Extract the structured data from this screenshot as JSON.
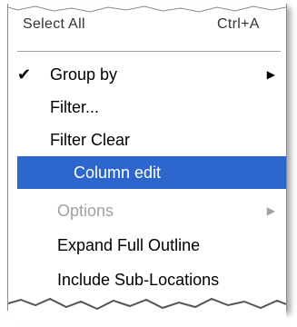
{
  "menu": {
    "top_item": {
      "label": "Select All",
      "shortcut": "Ctrl+A"
    },
    "items": [
      {
        "label": "Group by",
        "checked": true,
        "submenu": true,
        "disabled": false,
        "highlighted": false
      },
      {
        "label": "Filter...",
        "checked": false,
        "submenu": false,
        "disabled": false,
        "highlighted": false
      },
      {
        "label": "Filter Clear",
        "checked": false,
        "submenu": false,
        "disabled": false,
        "highlighted": false
      },
      {
        "label": "Column edit",
        "checked": false,
        "submenu": false,
        "disabled": false,
        "highlighted": true
      },
      {
        "label": "Options",
        "checked": false,
        "submenu": true,
        "disabled": true,
        "highlighted": false
      },
      {
        "label": "Expand Full Outline",
        "checked": false,
        "submenu": false,
        "disabled": false,
        "highlighted": false
      },
      {
        "label": "Include Sub-Locations",
        "checked": false,
        "submenu": false,
        "disabled": false,
        "highlighted": false
      }
    ],
    "colors": {
      "highlight": "#2d66cc",
      "disabled_text": "#a0a0a0"
    },
    "icons": {
      "check": "checkmark-icon",
      "submenu": "submenu-arrow-icon"
    }
  }
}
